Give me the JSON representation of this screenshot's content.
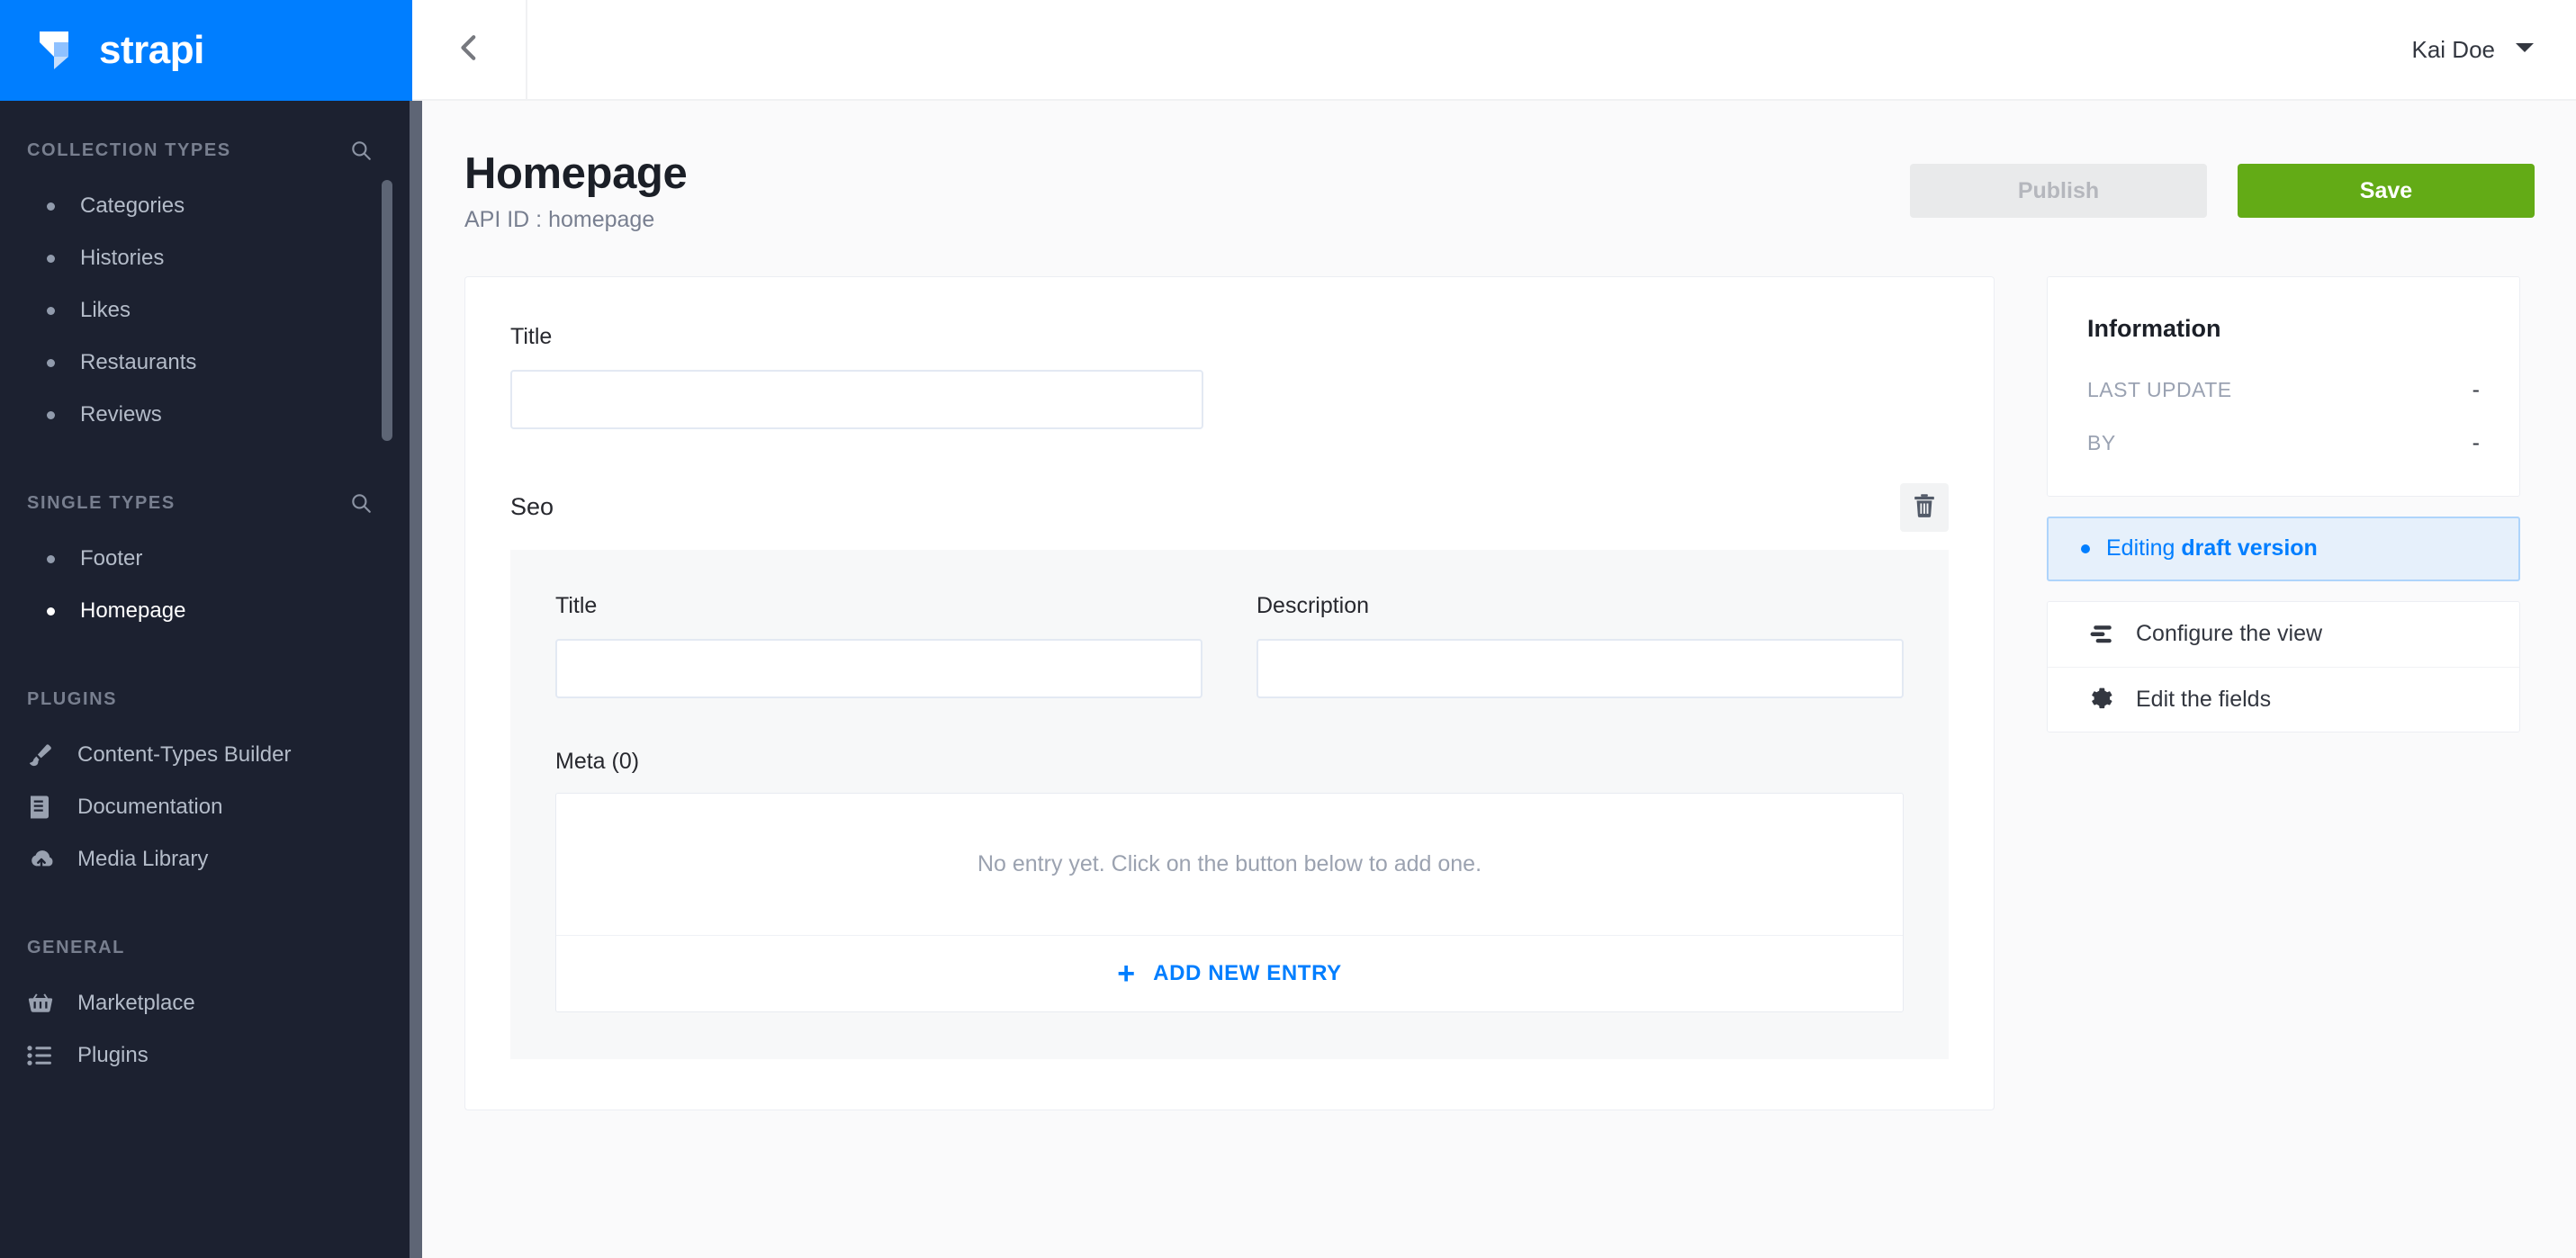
{
  "brand": {
    "name": "strapi",
    "logo_icon": "strapi-logo",
    "color": "#007eff"
  },
  "sidebar": {
    "sections": [
      {
        "title": "COLLECTION TYPES",
        "search_icon": "search-icon",
        "has_search": true,
        "scrollable": true,
        "items": [
          {
            "label": "Categories",
            "active": false
          },
          {
            "label": "Histories",
            "active": false
          },
          {
            "label": "Likes",
            "active": false
          },
          {
            "label": "Restaurants",
            "active": false
          },
          {
            "label": "Reviews",
            "active": false
          }
        ]
      },
      {
        "title": "SINGLE TYPES",
        "search_icon": "search-icon",
        "has_search": true,
        "scrollable": false,
        "items": [
          {
            "label": "Footer",
            "active": false
          },
          {
            "label": "Homepage",
            "active": true
          }
        ]
      },
      {
        "title": "PLUGINS",
        "has_search": false,
        "scrollable": false,
        "items": [
          {
            "label": "Content-Types Builder",
            "icon": "paintbrush-icon"
          },
          {
            "label": "Documentation",
            "icon": "book-icon"
          },
          {
            "label": "Media Library",
            "icon": "cloud-upload-icon"
          }
        ]
      },
      {
        "title": "GENERAL",
        "has_search": false,
        "scrollable": false,
        "items": [
          {
            "label": "Marketplace",
            "icon": "shopping-basket-icon"
          },
          {
            "label": "Plugins",
            "icon": "list-icon"
          }
        ]
      }
    ]
  },
  "topbar": {
    "back_icon": "chevron-left-icon",
    "user_name": "Kai Doe",
    "user_caret_icon": "caret-down-icon"
  },
  "page": {
    "title": "Homepage",
    "subtitle": "API ID : homepage",
    "publish_label": "Publish",
    "publish_disabled": true,
    "save_label": "Save",
    "save_color": "#63ab16"
  },
  "form": {
    "title_field": {
      "label": "Title",
      "value": "",
      "placeholder": ""
    },
    "component": {
      "name": "Seo",
      "delete_icon": "trash-icon",
      "fields": [
        {
          "label": "Title",
          "value": "",
          "placeholder": ""
        },
        {
          "label": "Description",
          "value": "",
          "placeholder": ""
        }
      ],
      "repeatable": {
        "label": "Meta (0)",
        "count": 0,
        "empty_text": "No entry yet. Click on the button below to add one.",
        "add_label": "ADD NEW ENTRY",
        "add_icon": "plus-icon"
      }
    }
  },
  "rail": {
    "information": {
      "title": "Information",
      "rows": [
        {
          "key": "LAST UPDATE",
          "value": "-"
        },
        {
          "key": "BY",
          "value": "-"
        }
      ]
    },
    "draft_banner": {
      "prefix": "Editing ",
      "emphasis": "draft version",
      "dot_icon": "status-dot-icon",
      "accent": "#007eff"
    },
    "links": [
      {
        "label": "Configure the view",
        "icon": "layout-settings-icon"
      },
      {
        "label": "Edit the fields",
        "icon": "gear-icon"
      }
    ]
  }
}
